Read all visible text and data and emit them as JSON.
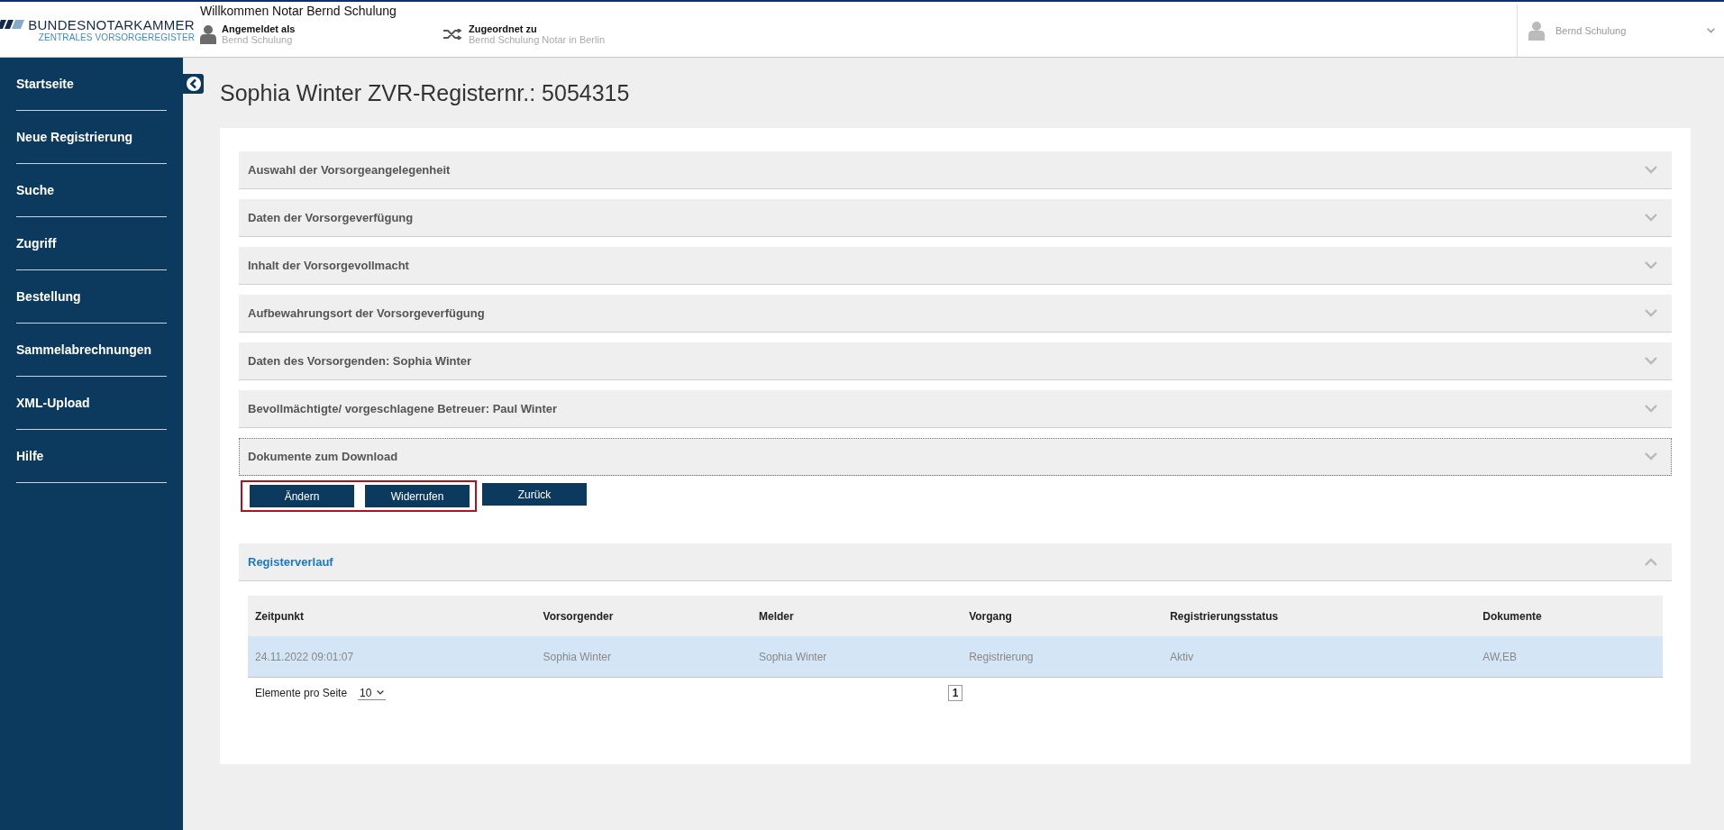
{
  "header": {
    "logo": {
      "name": "BUNDESNOTARKAMMER",
      "subtitle": "ZENTRALES VORSORGEREGISTER"
    },
    "welcome": "Willkommen Notar Bernd Schulung",
    "logged_in": {
      "label": "Angemeldet als",
      "value": "Bernd Schulung"
    },
    "assigned": {
      "label": "Zugeordnet zu",
      "value": "Bernd Schulung Notar in Berlin"
    },
    "user_menu": {
      "name": "Bernd Schulung"
    }
  },
  "sidebar": {
    "items": [
      {
        "label": "Startseite",
        "selected": false
      },
      {
        "label": "Neue Registrierung",
        "selected": false
      },
      {
        "label": "Suche",
        "selected": false
      },
      {
        "label": "Zugriff",
        "selected": false
      },
      {
        "label": "Bestellung",
        "selected": false
      },
      {
        "label": "Sammelabrechnungen",
        "selected": false
      },
      {
        "label": "XML-Upload",
        "selected": false
      },
      {
        "label": "Hilfe",
        "selected": false
      }
    ]
  },
  "page_title": "Sophia Winter ZVR-Registernr.: 5054315",
  "sections": [
    {
      "title": "Auswahl der Vorsorgeangelegenheit",
      "expanded": false,
      "focused": false
    },
    {
      "title": "Daten der Vorsorgeverfügung",
      "expanded": false,
      "focused": false
    },
    {
      "title": "Inhalt der Vorsorgevollmacht",
      "expanded": false,
      "focused": false
    },
    {
      "title": "Aufbewahrungsort der Vorsorgeverfügung",
      "expanded": false,
      "focused": false
    },
    {
      "title": "Daten des Vorsorgenden: Sophia Winter",
      "expanded": false,
      "focused": false
    },
    {
      "title": "Bevollmächtigte/ vorgeschlagene Betreuer: Paul Winter",
      "expanded": false,
      "focused": false
    },
    {
      "title": "Dokumente zum Download",
      "expanded": false,
      "focused": true
    }
  ],
  "buttons": [
    {
      "label": "Ändern",
      "highlighted": true
    },
    {
      "label": "Widerrufen",
      "highlighted": true
    },
    {
      "label": "Zurück",
      "highlighted": false
    }
  ],
  "history": {
    "title": "Registerverlauf",
    "expanded": true,
    "table": {
      "columns": [
        "Zeitpunkt",
        "Vorsorgender",
        "Melder",
        "Vorgang",
        "Registrierungsstatus",
        "Dokumente"
      ],
      "rows": [
        {
          "cells": [
            "24.11.2022 09:01:07",
            "Sophia Winter",
            "Sophia Winter",
            "Registrierung",
            "Aktiv",
            "AW,EB"
          ],
          "selected": true
        }
      ]
    },
    "page_size_label": "Elemente pro Seite",
    "page_size": "10",
    "pages": [
      {
        "label": "1",
        "selected": true
      }
    ]
  }
}
